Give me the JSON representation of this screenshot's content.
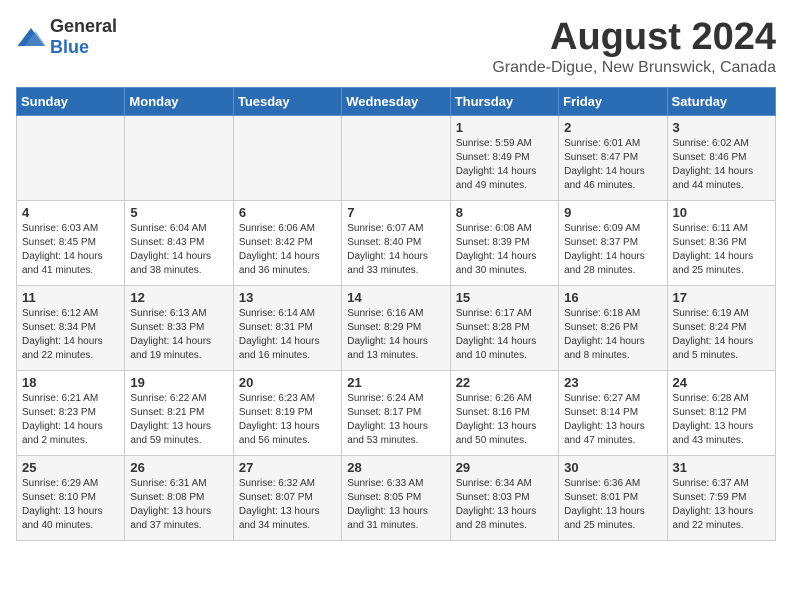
{
  "header": {
    "logo_general": "General",
    "logo_blue": "Blue",
    "month_year": "August 2024",
    "location": "Grande-Digue, New Brunswick, Canada"
  },
  "days_of_week": [
    "Sunday",
    "Monday",
    "Tuesday",
    "Wednesday",
    "Thursday",
    "Friday",
    "Saturday"
  ],
  "weeks": [
    [
      {
        "day": "",
        "info": ""
      },
      {
        "day": "",
        "info": ""
      },
      {
        "day": "",
        "info": ""
      },
      {
        "day": "",
        "info": ""
      },
      {
        "day": "1",
        "info": "Sunrise: 5:59 AM\nSunset: 8:49 PM\nDaylight: 14 hours\nand 49 minutes."
      },
      {
        "day": "2",
        "info": "Sunrise: 6:01 AM\nSunset: 8:47 PM\nDaylight: 14 hours\nand 46 minutes."
      },
      {
        "day": "3",
        "info": "Sunrise: 6:02 AM\nSunset: 8:46 PM\nDaylight: 14 hours\nand 44 minutes."
      }
    ],
    [
      {
        "day": "4",
        "info": "Sunrise: 6:03 AM\nSunset: 8:45 PM\nDaylight: 14 hours\nand 41 minutes."
      },
      {
        "day": "5",
        "info": "Sunrise: 6:04 AM\nSunset: 8:43 PM\nDaylight: 14 hours\nand 38 minutes."
      },
      {
        "day": "6",
        "info": "Sunrise: 6:06 AM\nSunset: 8:42 PM\nDaylight: 14 hours\nand 36 minutes."
      },
      {
        "day": "7",
        "info": "Sunrise: 6:07 AM\nSunset: 8:40 PM\nDaylight: 14 hours\nand 33 minutes."
      },
      {
        "day": "8",
        "info": "Sunrise: 6:08 AM\nSunset: 8:39 PM\nDaylight: 14 hours\nand 30 minutes."
      },
      {
        "day": "9",
        "info": "Sunrise: 6:09 AM\nSunset: 8:37 PM\nDaylight: 14 hours\nand 28 minutes."
      },
      {
        "day": "10",
        "info": "Sunrise: 6:11 AM\nSunset: 8:36 PM\nDaylight: 14 hours\nand 25 minutes."
      }
    ],
    [
      {
        "day": "11",
        "info": "Sunrise: 6:12 AM\nSunset: 8:34 PM\nDaylight: 14 hours\nand 22 minutes."
      },
      {
        "day": "12",
        "info": "Sunrise: 6:13 AM\nSunset: 8:33 PM\nDaylight: 14 hours\nand 19 minutes."
      },
      {
        "day": "13",
        "info": "Sunrise: 6:14 AM\nSunset: 8:31 PM\nDaylight: 14 hours\nand 16 minutes."
      },
      {
        "day": "14",
        "info": "Sunrise: 6:16 AM\nSunset: 8:29 PM\nDaylight: 14 hours\nand 13 minutes."
      },
      {
        "day": "15",
        "info": "Sunrise: 6:17 AM\nSunset: 8:28 PM\nDaylight: 14 hours\nand 10 minutes."
      },
      {
        "day": "16",
        "info": "Sunrise: 6:18 AM\nSunset: 8:26 PM\nDaylight: 14 hours\nand 8 minutes."
      },
      {
        "day": "17",
        "info": "Sunrise: 6:19 AM\nSunset: 8:24 PM\nDaylight: 14 hours\nand 5 minutes."
      }
    ],
    [
      {
        "day": "18",
        "info": "Sunrise: 6:21 AM\nSunset: 8:23 PM\nDaylight: 14 hours\nand 2 minutes."
      },
      {
        "day": "19",
        "info": "Sunrise: 6:22 AM\nSunset: 8:21 PM\nDaylight: 13 hours\nand 59 minutes."
      },
      {
        "day": "20",
        "info": "Sunrise: 6:23 AM\nSunset: 8:19 PM\nDaylight: 13 hours\nand 56 minutes."
      },
      {
        "day": "21",
        "info": "Sunrise: 6:24 AM\nSunset: 8:17 PM\nDaylight: 13 hours\nand 53 minutes."
      },
      {
        "day": "22",
        "info": "Sunrise: 6:26 AM\nSunset: 8:16 PM\nDaylight: 13 hours\nand 50 minutes."
      },
      {
        "day": "23",
        "info": "Sunrise: 6:27 AM\nSunset: 8:14 PM\nDaylight: 13 hours\nand 47 minutes."
      },
      {
        "day": "24",
        "info": "Sunrise: 6:28 AM\nSunset: 8:12 PM\nDaylight: 13 hours\nand 43 minutes."
      }
    ],
    [
      {
        "day": "25",
        "info": "Sunrise: 6:29 AM\nSunset: 8:10 PM\nDaylight: 13 hours\nand 40 minutes."
      },
      {
        "day": "26",
        "info": "Sunrise: 6:31 AM\nSunset: 8:08 PM\nDaylight: 13 hours\nand 37 minutes."
      },
      {
        "day": "27",
        "info": "Sunrise: 6:32 AM\nSunset: 8:07 PM\nDaylight: 13 hours\nand 34 minutes."
      },
      {
        "day": "28",
        "info": "Sunrise: 6:33 AM\nSunset: 8:05 PM\nDaylight: 13 hours\nand 31 minutes."
      },
      {
        "day": "29",
        "info": "Sunrise: 6:34 AM\nSunset: 8:03 PM\nDaylight: 13 hours\nand 28 minutes."
      },
      {
        "day": "30",
        "info": "Sunrise: 6:36 AM\nSunset: 8:01 PM\nDaylight: 13 hours\nand 25 minutes."
      },
      {
        "day": "31",
        "info": "Sunrise: 6:37 AM\nSunset: 7:59 PM\nDaylight: 13 hours\nand 22 minutes."
      }
    ]
  ]
}
